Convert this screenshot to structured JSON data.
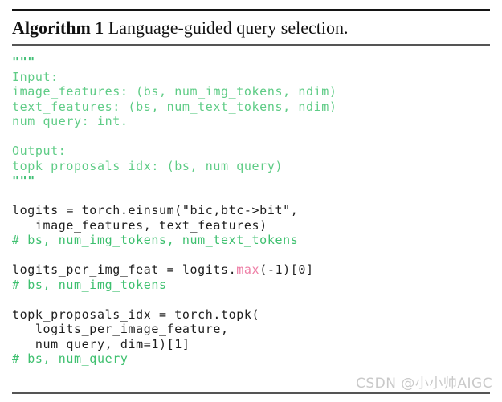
{
  "document": {
    "type": "algorithm-listing",
    "background_color": "#ffffff",
    "rules": {
      "top_color": "#141414",
      "mid_color": "#555555",
      "bottom_color": "#555555"
    }
  },
  "title": {
    "keyword": "Algorithm 1",
    "separator": " ",
    "description": "Language-guided query selection."
  },
  "colors": {
    "code_text": "#1e1e1e",
    "docstring": "#3fbf74",
    "docstring_body": "#5fcc86",
    "comment": "#3ec06f",
    "builtin": "#ee7fa6",
    "watermark": "#c9c9c9"
  },
  "code": {
    "language": "python",
    "lines": [
      {
        "indent": 0,
        "segments": [
          {
            "text": "\"\"\"",
            "style": "doc"
          }
        ]
      },
      {
        "indent": 0,
        "segments": [
          {
            "text": "Input:",
            "style": "docbody"
          }
        ]
      },
      {
        "indent": 0,
        "segments": [
          {
            "text": "image_features: (bs, num_img_tokens, ndim)",
            "style": "docbody"
          }
        ]
      },
      {
        "indent": 0,
        "segments": [
          {
            "text": "text_features: (bs, num_text_tokens, ndim)",
            "style": "docbody"
          }
        ]
      },
      {
        "indent": 0,
        "segments": [
          {
            "text": "num_query: int.",
            "style": "docbody"
          }
        ]
      },
      {
        "indent": 0,
        "segments": []
      },
      {
        "indent": 0,
        "segments": [
          {
            "text": "Output:",
            "style": "docbody"
          }
        ]
      },
      {
        "indent": 0,
        "segments": [
          {
            "text": "topk_proposals_idx: (bs, num_query)",
            "style": "docbody"
          }
        ]
      },
      {
        "indent": 0,
        "segments": [
          {
            "text": "\"\"\"",
            "style": "doc"
          }
        ]
      },
      {
        "indent": 0,
        "segments": []
      },
      {
        "indent": 0,
        "segments": [
          {
            "text": "logits = torch.einsum(\"bic,btc->bit\",",
            "style": "plain"
          }
        ]
      },
      {
        "indent": 0,
        "segments": [
          {
            "text": "   image_features, text_features)",
            "style": "plain"
          }
        ]
      },
      {
        "indent": 0,
        "segments": [
          {
            "text": "# bs, num_img_tokens, num_text_tokens",
            "style": "comment"
          }
        ]
      },
      {
        "indent": 0,
        "segments": []
      },
      {
        "indent": 0,
        "segments": [
          {
            "text": "logits_per_img_feat = logits.",
            "style": "plain"
          },
          {
            "text": "max",
            "style": "builtin"
          },
          {
            "text": "(-1)[0]",
            "style": "plain"
          }
        ]
      },
      {
        "indent": 0,
        "segments": [
          {
            "text": "# bs, num_img_tokens",
            "style": "comment"
          }
        ]
      },
      {
        "indent": 0,
        "segments": []
      },
      {
        "indent": 0,
        "segments": [
          {
            "text": "topk_proposals_idx = torch.topk(",
            "style": "plain"
          }
        ]
      },
      {
        "indent": 0,
        "segments": [
          {
            "text": "   logits_per_image_feature,",
            "style": "plain"
          }
        ]
      },
      {
        "indent": 0,
        "segments": [
          {
            "text": "   num_query, dim=1)[1]",
            "style": "plain"
          }
        ]
      },
      {
        "indent": 0,
        "segments": [
          {
            "text": "# bs, num_query",
            "style": "comment"
          }
        ]
      }
    ]
  },
  "watermark": {
    "text": "CSDN @小小帅AIGC"
  }
}
